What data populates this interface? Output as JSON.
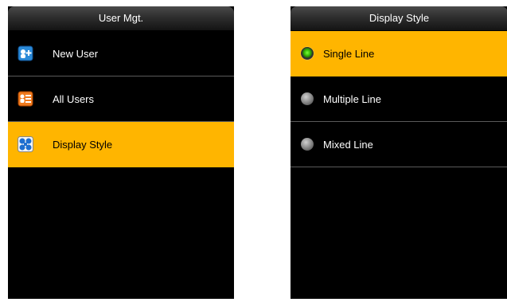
{
  "left_screen": {
    "title": "User Mgt.",
    "items": [
      {
        "label": "New User",
        "icon": "add-user-icon"
      },
      {
        "label": "All Users",
        "icon": "user-list-icon"
      },
      {
        "label": "Display Style",
        "icon": "display-style-icon"
      }
    ],
    "selected_index": 2
  },
  "right_screen": {
    "title": "Display Style",
    "options": [
      {
        "label": "Single Line",
        "checked": true
      },
      {
        "label": "Multiple Line",
        "checked": false
      },
      {
        "label": "Mixed Line",
        "checked": false
      }
    ]
  },
  "colors": {
    "highlight": "#ffb500",
    "background": "#000000",
    "divider": "#5a5a5a",
    "text": "#ffffff"
  }
}
